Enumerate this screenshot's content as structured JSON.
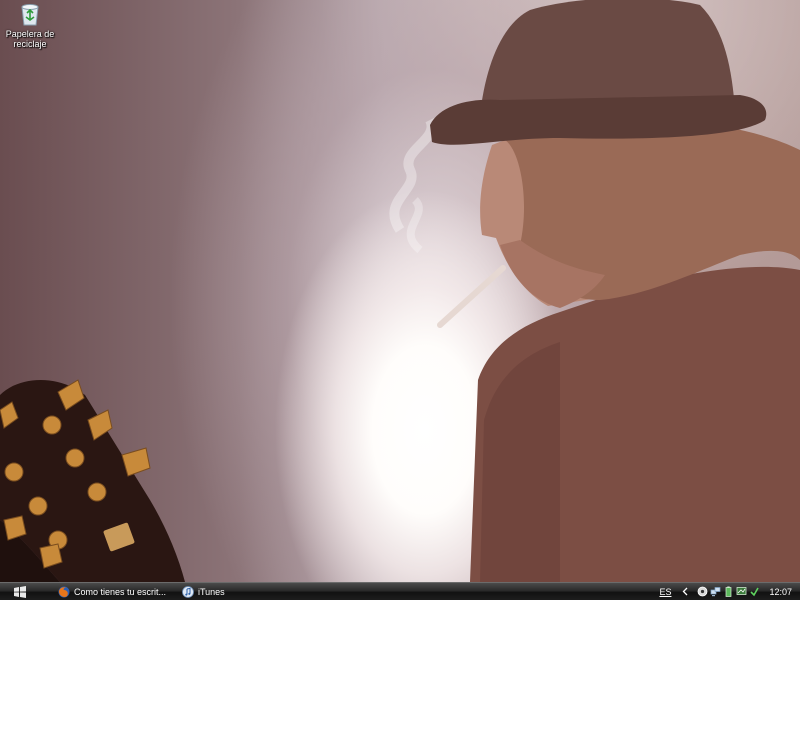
{
  "desktop": {
    "icons": [
      {
        "label": "Papelera de reciclaje",
        "icon": "recycle-bin-icon"
      }
    ]
  },
  "taskbar": {
    "start_icon": "windows-logo-icon",
    "tasks": [
      {
        "label": "Como tienes tu escrit...",
        "icon": "firefox-icon"
      },
      {
        "label": "iTunes",
        "icon": "itunes-icon"
      }
    ],
    "tray": {
      "language": "ES",
      "expand_icon": "chevron-left-icon",
      "icons": [
        "media-icon",
        "network-icon",
        "battery-icon",
        "display-icon",
        "safely-remove-icon"
      ],
      "clock": "12:07"
    }
  },
  "colors": {
    "taskbar": "#1d1d1d",
    "desktop_shadow": "#6a4d50",
    "backlight": "#ffffff"
  }
}
